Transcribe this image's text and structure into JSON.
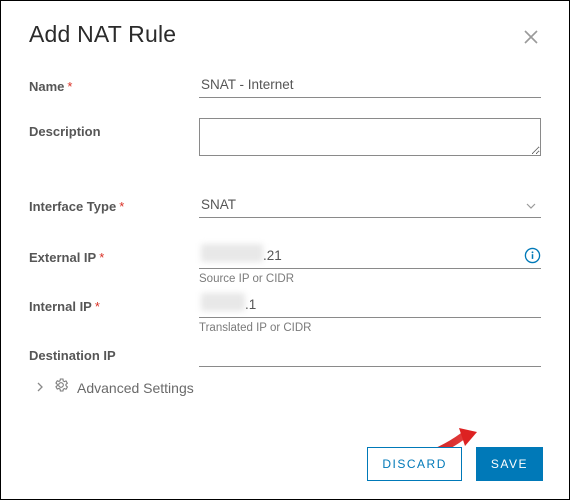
{
  "header": {
    "title": "Add NAT Rule"
  },
  "fields": {
    "name": {
      "label": "Name",
      "required": true,
      "value": "SNAT - Internet"
    },
    "description": {
      "label": "Description",
      "required": false,
      "value": ""
    },
    "interfaceType": {
      "label": "Interface Type",
      "required": true,
      "value": "SNAT"
    },
    "externalIp": {
      "label": "External IP",
      "required": true,
      "visible": ".21",
      "hint": "Source IP or CIDR"
    },
    "internalIp": {
      "label": "Internal IP",
      "required": true,
      "visible": ".1",
      "hint": "Translated IP or CIDR"
    },
    "destinationIp": {
      "label": "Destination IP",
      "required": false,
      "value": ""
    }
  },
  "advanced": {
    "label": "Advanced Settings"
  },
  "footer": {
    "discard": "DISCARD",
    "save": "SAVE"
  },
  "icons": {
    "close": "close-icon",
    "chevron": "chevron-down-icon",
    "info": "info-icon",
    "gear": "gear-icon",
    "caret": "caret-right-icon"
  }
}
